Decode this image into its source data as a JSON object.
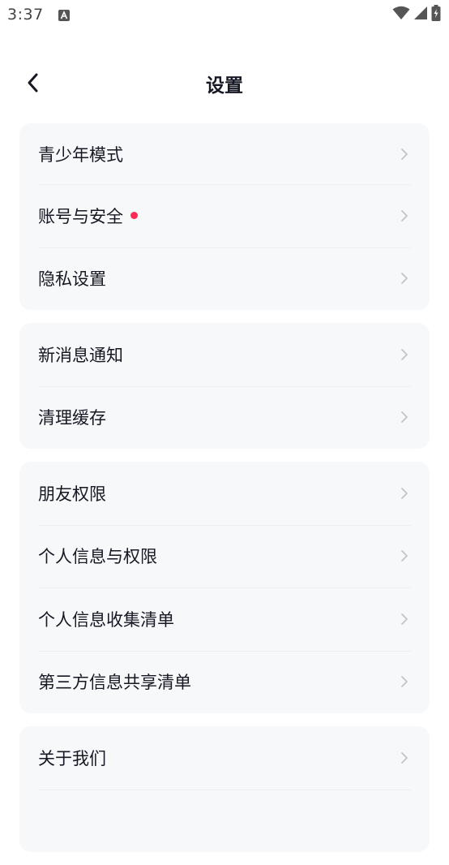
{
  "status_bar": {
    "time": "3:37"
  },
  "header": {
    "title": "设置"
  },
  "groups": [
    {
      "items": [
        {
          "label": "青少年模式",
          "dot": false
        },
        {
          "label": "账号与安全",
          "dot": true
        },
        {
          "label": "隐私设置",
          "dot": false
        }
      ]
    },
    {
      "items": [
        {
          "label": "新消息通知",
          "dot": false
        },
        {
          "label": "清理缓存",
          "dot": false
        }
      ]
    },
    {
      "items": [
        {
          "label": "朋友权限",
          "dot": false
        },
        {
          "label": "个人信息与权限",
          "dot": false
        },
        {
          "label": "个人信息收集清单",
          "dot": false
        },
        {
          "label": "第三方信息共享清单",
          "dot": false
        }
      ]
    },
    {
      "items": [
        {
          "label": "关于我们",
          "dot": false
        },
        {
          "label": "",
          "dot": false
        }
      ]
    }
  ],
  "colors": {
    "badge": "#fe2c55",
    "card_bg": "#f7f8fa",
    "chevron": "#c2c4c9"
  },
  "icons": {
    "back": "back-arrow-icon",
    "chevron": "chevron-right-icon",
    "wifi": "wifi-icon",
    "signal": "signal-icon",
    "battery": "battery-charging-icon",
    "notification": "app-notification-icon"
  }
}
